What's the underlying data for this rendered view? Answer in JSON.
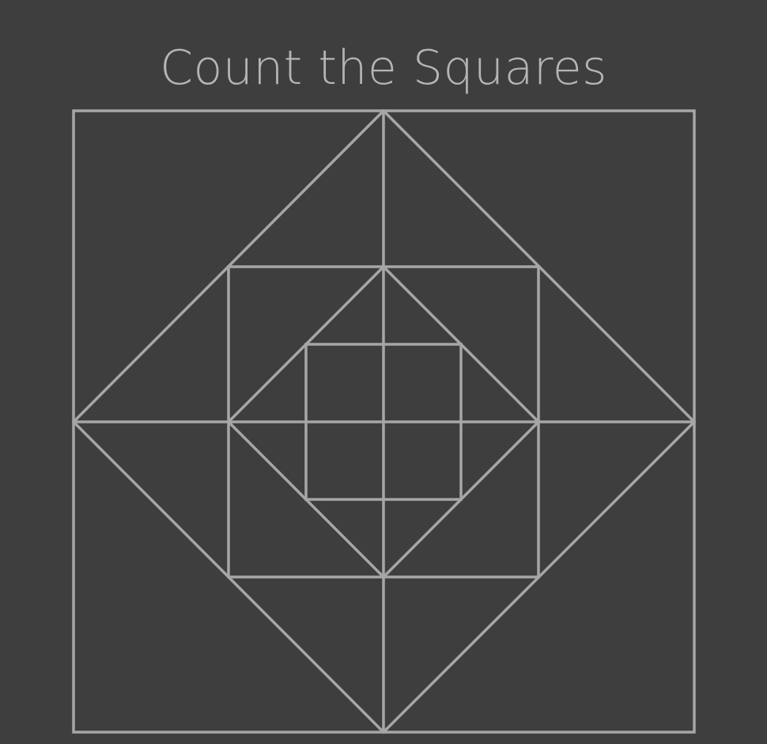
{
  "title": "Count the Squares",
  "colors": {
    "background": "#3e3e3e",
    "line": "#a6a6a6",
    "title": "#b5b5b5"
  }
}
